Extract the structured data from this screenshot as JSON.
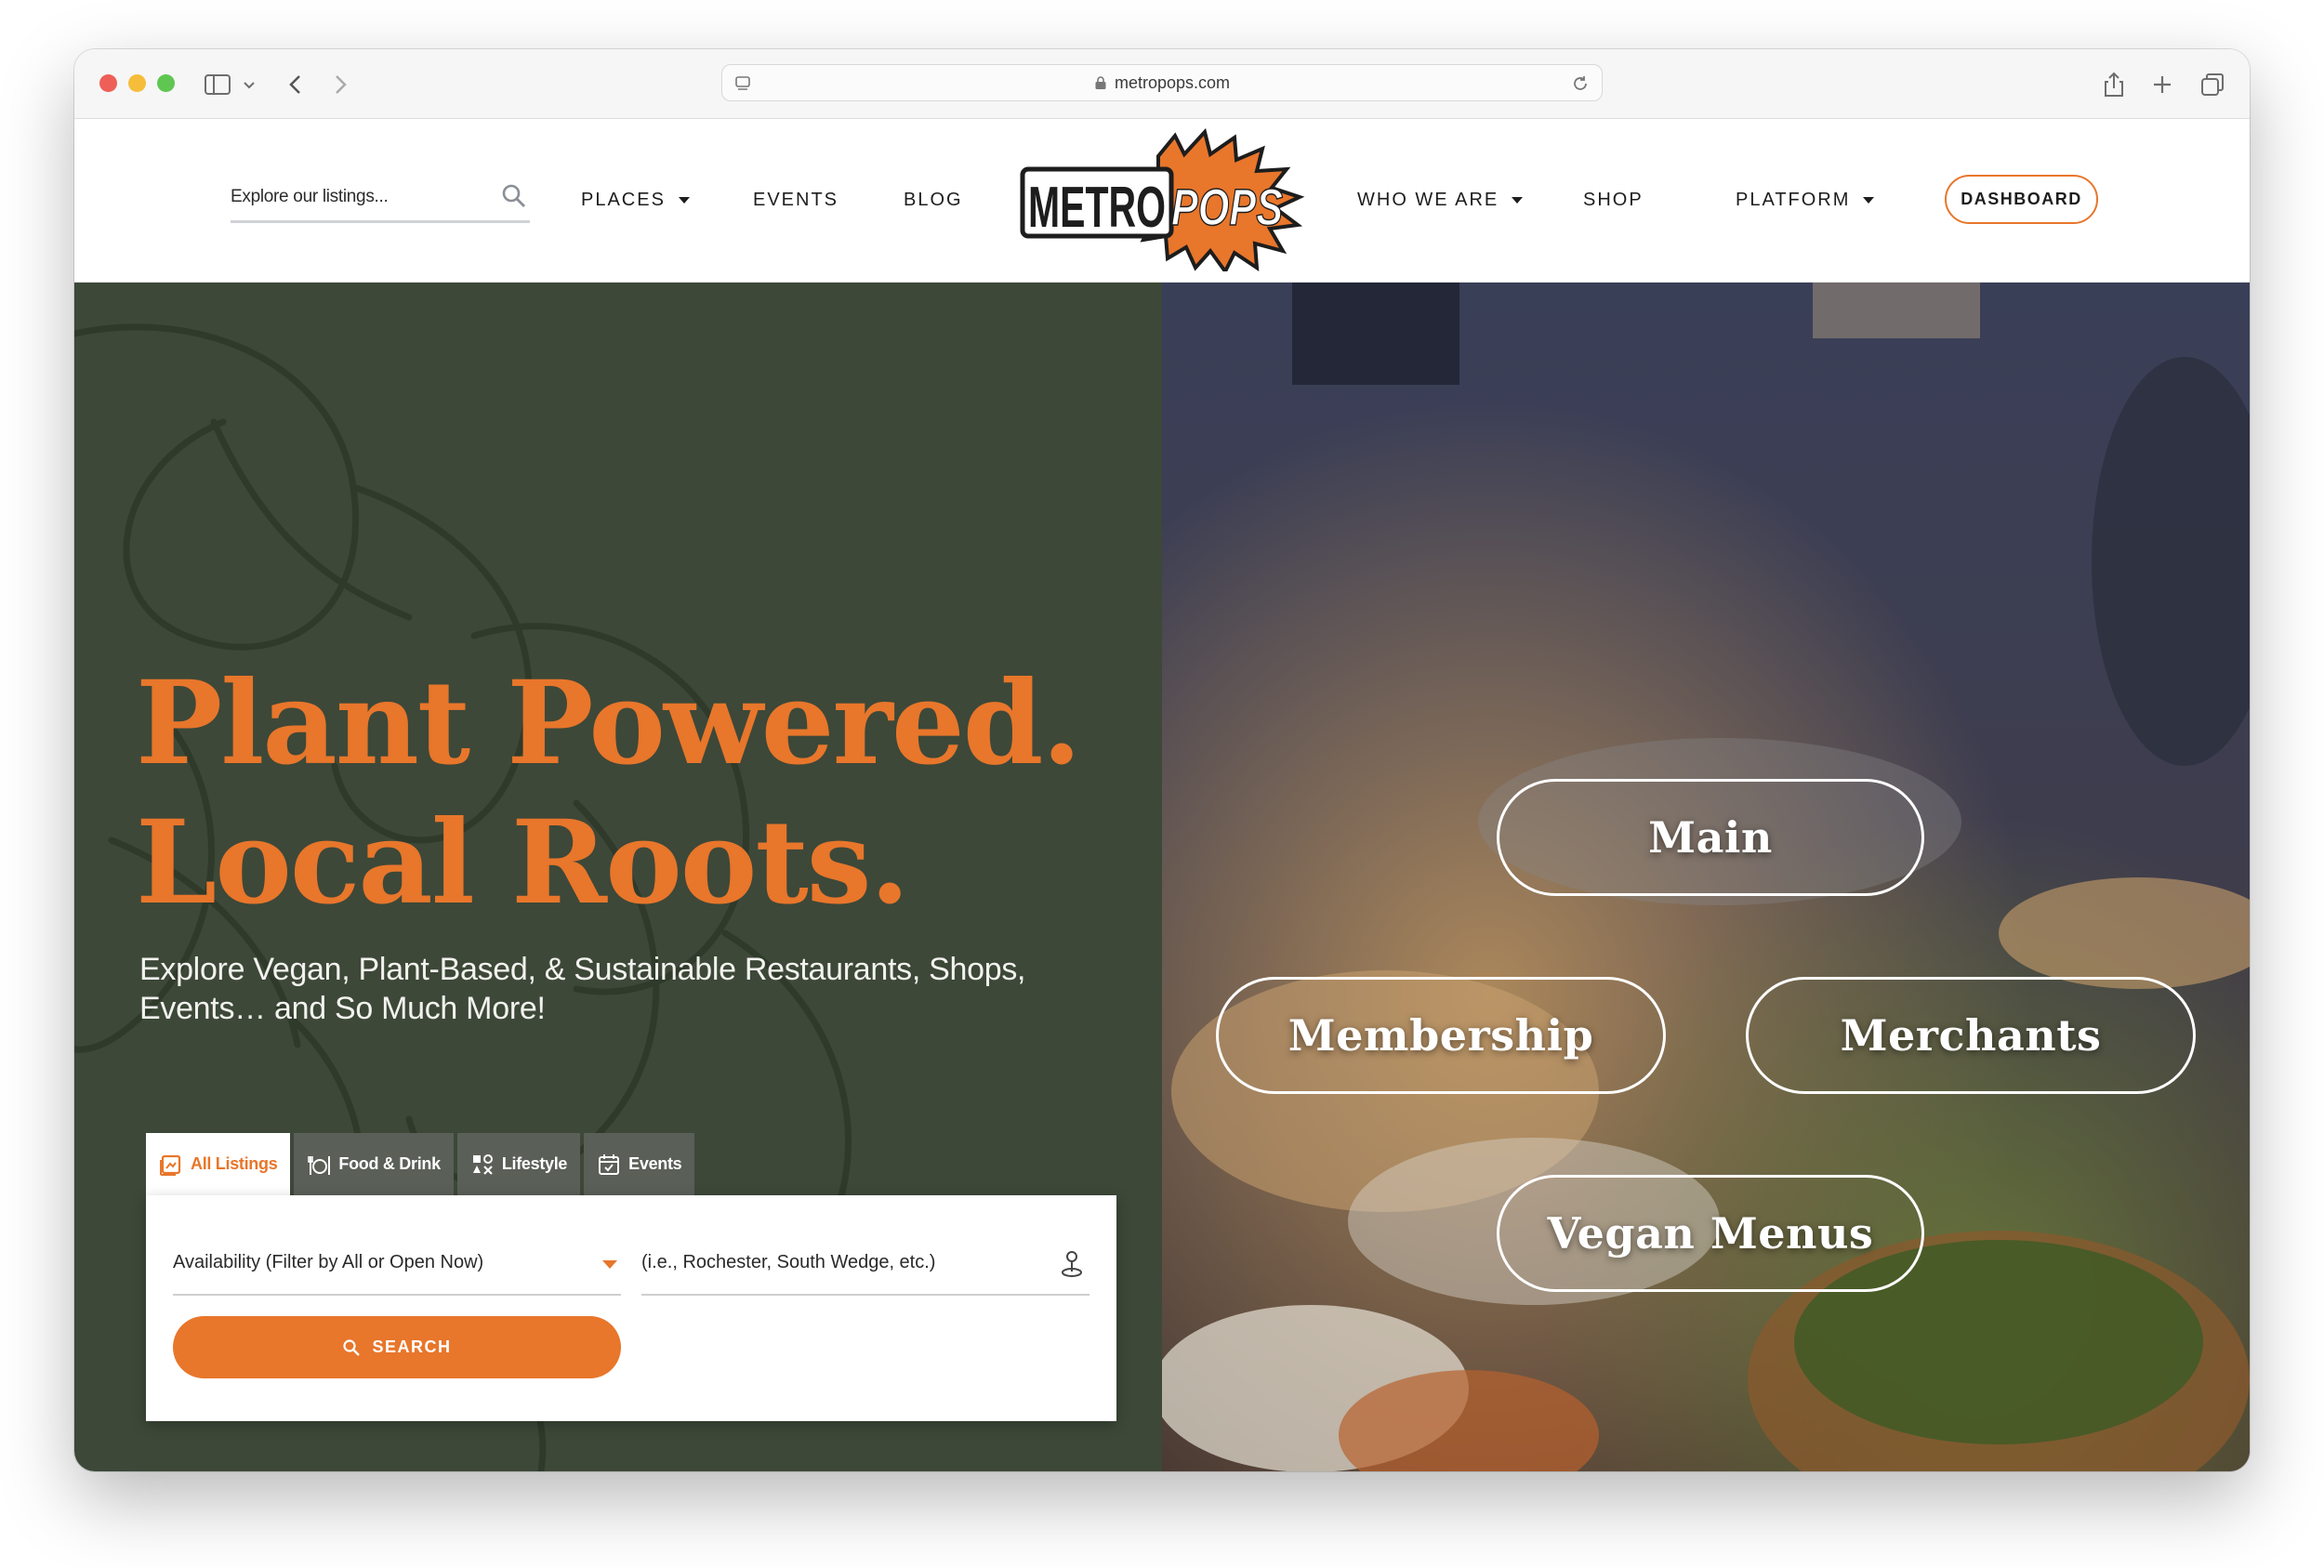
{
  "browser": {
    "url": "metropops.com"
  },
  "header": {
    "search_placeholder": "Explore our listings...",
    "nav": {
      "places": "PLACES",
      "events": "EVENTS",
      "blog": "BLOG",
      "who_we_are": "WHO WE ARE",
      "shop": "SHOP",
      "platform": "PLATFORM"
    },
    "logo": {
      "word1": "METRO",
      "word2": "POPS"
    },
    "dashboard_label": "DASHBOARD"
  },
  "hero": {
    "title_line1": "Plant Powered.",
    "title_line2": "Local Roots.",
    "subtitle": "Explore Vegan, Plant-Based, & Sustainable Restaurants, Shops, Events… and So Much More!",
    "tabs": [
      {
        "label": "All Listings",
        "icon": "listings-icon",
        "active": true
      },
      {
        "label": "Food & Drink",
        "icon": "food-drink-icon",
        "active": false
      },
      {
        "label": "Lifestyle",
        "icon": "lifestyle-icon",
        "active": false
      },
      {
        "label": "Events",
        "icon": "calendar-icon",
        "active": false
      }
    ],
    "availability_value": "Availability (Filter by All or Open Now)",
    "location_placeholder": "(i.e., Rochester, South Wedge, etc.)",
    "search_label": "SEARCH"
  },
  "pills": {
    "main": "Main",
    "membership": "Membership",
    "merchants": "Merchants",
    "vegan_menus": "Vegan Menus"
  },
  "colors": {
    "accent": "#e8762b",
    "hero_green": "#3d4838",
    "tab_gray": "#5a5f58"
  }
}
